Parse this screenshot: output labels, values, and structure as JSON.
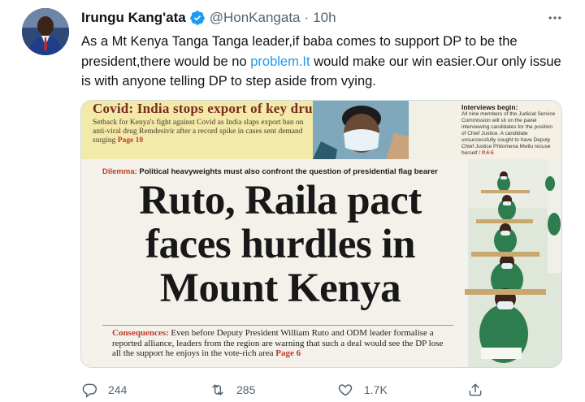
{
  "tweet": {
    "display_name": "Irungu Kang'ata",
    "handle": "@HonKangata",
    "separator": "·",
    "time": "10h",
    "text_before_link": "As a Mt Kenya Tanga Tanga leader,if baba comes to support DP to be the president,there would be no ",
    "link_text": "problem.It",
    "text_after_link": " would make our win easier.Our only issue is with anyone telling DP to step aside from vying.",
    "actions": {
      "replies": "244",
      "retweets": "285",
      "likes": "1.7K"
    }
  },
  "newspaper": {
    "top_headline": "Covid: India stops export of key drug",
    "top_sub": "Setback for Kenya's fight against Covid as India slaps export ban on anti-viral drug Remdesivir after a record spike in cases sent demand surging",
    "top_sub_page": "Page 10",
    "side_title": "Interviews begin:",
    "side_body": "All nine members of the Judicial Service Commission will sit on the panel interviewing candidates for the position of Chief Justice. A candidate unsuccessfully sought to have Deputy Chief Justice Philomena Mwilu recuse herself /",
    "side_page": "P.4-5",
    "kicker_label": "Dilemma:",
    "kicker_text": " Political heavyweights must also confront the question of presidential flag bearer",
    "headline_line1": "Ruto, Raila pact",
    "headline_line2": "faces hurdles in",
    "headline_line3": "Mount Kenya",
    "bottom_label": "Consequences:",
    "bottom_text": " Even before Deputy President William Ruto and ODM leader formalise a reported alliance, leaders from the region are warning that such a deal would see the DP lose all the support he enjoys in the vote-rich area",
    "bottom_page": "Page 6"
  },
  "colors": {
    "link": "#1d9bf0",
    "muted": "#536471",
    "verified": "#1d9bf0",
    "paper_red": "#c0392b"
  },
  "icons": [
    "more-icon",
    "verified-badge-icon",
    "reply-icon",
    "retweet-icon",
    "like-icon",
    "share-icon"
  ]
}
